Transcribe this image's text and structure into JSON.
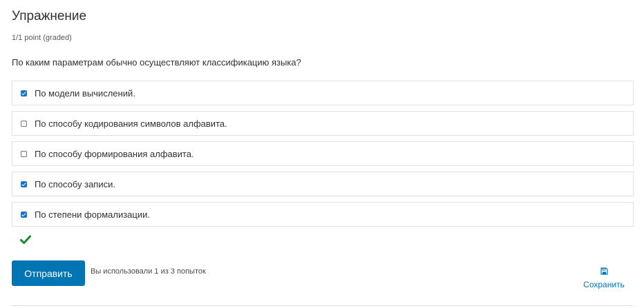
{
  "problem": {
    "title": "Упражнение",
    "points": "1/1 point (graded)",
    "question": "По каким параметрам обычно осуществляют классификацию языка?"
  },
  "choices": [
    {
      "label": "По модели вычислений.",
      "checked": true
    },
    {
      "label": "По способу кодирования символов алфавита.",
      "checked": false
    },
    {
      "label": "По способу формирования алфавита.",
      "checked": false
    },
    {
      "label": "По способу записи.",
      "checked": true
    },
    {
      "label": "По степени формализации.",
      "checked": true
    }
  ],
  "status": {
    "icon": "checkmark-icon",
    "color": "#178c2c"
  },
  "actions": {
    "submit_label": "Отправить",
    "attempts_text": "Вы использовали 1 из 3 попыток",
    "save_label": "Сохранить",
    "save_icon": "floppy-disk-icon"
  },
  "colors": {
    "accent": "#0075b4",
    "checkbox": "#1a73c8"
  }
}
